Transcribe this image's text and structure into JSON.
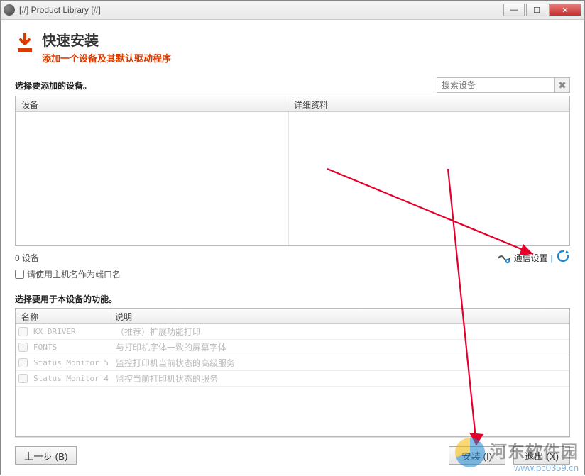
{
  "window": {
    "title": "[#] Product Library [#]"
  },
  "header": {
    "title": "快速安装",
    "subtitle": "添加一个设备及其默认驱动程序"
  },
  "search": {
    "placeholder": "搜索设备"
  },
  "devices": {
    "section_label": "选择要添加的设备。",
    "columns": {
      "device": "设备",
      "details": "详细资料"
    },
    "count_text": "0 设备",
    "hostname_checkbox_label": "请使用主机名作为端口名",
    "comm_settings_label": "通信设置"
  },
  "features": {
    "section_label": "选择要用于本设备的功能。",
    "columns": {
      "name": "名称",
      "desc": "说明"
    },
    "rows": [
      {
        "name": "KX DRIVER",
        "desc": "（推荐）扩展功能打印"
      },
      {
        "name": "FONTS",
        "desc": "与打印机字体一致的屏幕字体"
      },
      {
        "name": "Status Monitor 5",
        "desc": "监控打印机当前状态的高级服务"
      },
      {
        "name": "Status Monitor 4",
        "desc": "监控当前打印机状态的服务"
      }
    ]
  },
  "footer": {
    "back": "上一步 (B)",
    "install": "安装 (I)",
    "exit": "退出 (X)"
  },
  "watermark": {
    "title": "河东软件园",
    "url": "www.pc0359.cn"
  }
}
